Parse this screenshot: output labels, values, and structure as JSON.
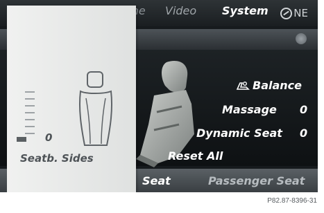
{
  "status": {
    "compass_heading": "NE"
  },
  "menu": {
    "items": [
      "one",
      "Video",
      "System"
    ],
    "active": "System"
  },
  "options": {
    "balance": "Balance",
    "massage": {
      "label": "Massage",
      "value": "0"
    },
    "dynamic_seat": {
      "label": "Dynamic Seat",
      "value": "0"
    },
    "reset": "Reset All"
  },
  "bottom_bar": {
    "seat": "Seat",
    "passenger_seat": "Passenger Seat"
  },
  "overlay": {
    "label": "Seatb. Sides",
    "value": "0",
    "level": 0
  },
  "caption": "P82.87-8396-31",
  "colors": {
    "screen_bg": "#161a1d",
    "overlay_bg": "#e8e9e8",
    "active_text": "#ffffff"
  }
}
